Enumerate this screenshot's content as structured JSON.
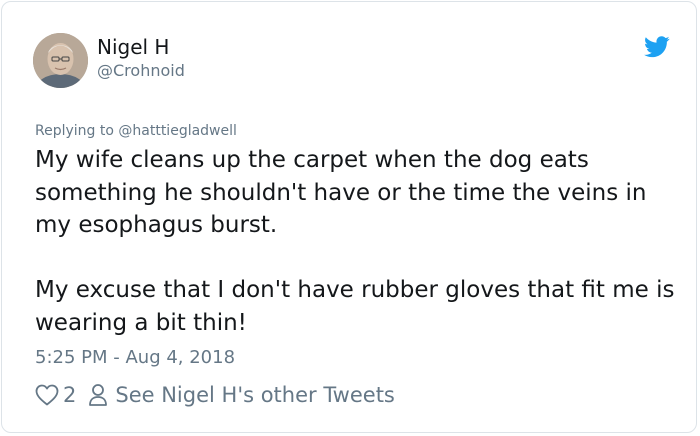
{
  "author": {
    "name": "Nigel H",
    "handle": "@Crohnoid"
  },
  "reply": {
    "prefix": "Replying to ",
    "to": "@hatttiegladwell"
  },
  "tweet": {
    "paragraphs": [
      "My wife cleans up the carpet when the dog eats something he shouldn't have or the time the veins in my esophagus burst.",
      "My excuse that I don't have rubber gloves that fit me is wearing a bit thin!"
    ],
    "timestamp": "5:25 PM - Aug 4, 2018"
  },
  "actions": {
    "likes": "2",
    "other_tweets": "See Nigel H's other Tweets"
  },
  "colors": {
    "twitter_blue": "#1da1f2",
    "text": "#14171a",
    "muted": "#657786",
    "border": "#dde3e8"
  }
}
